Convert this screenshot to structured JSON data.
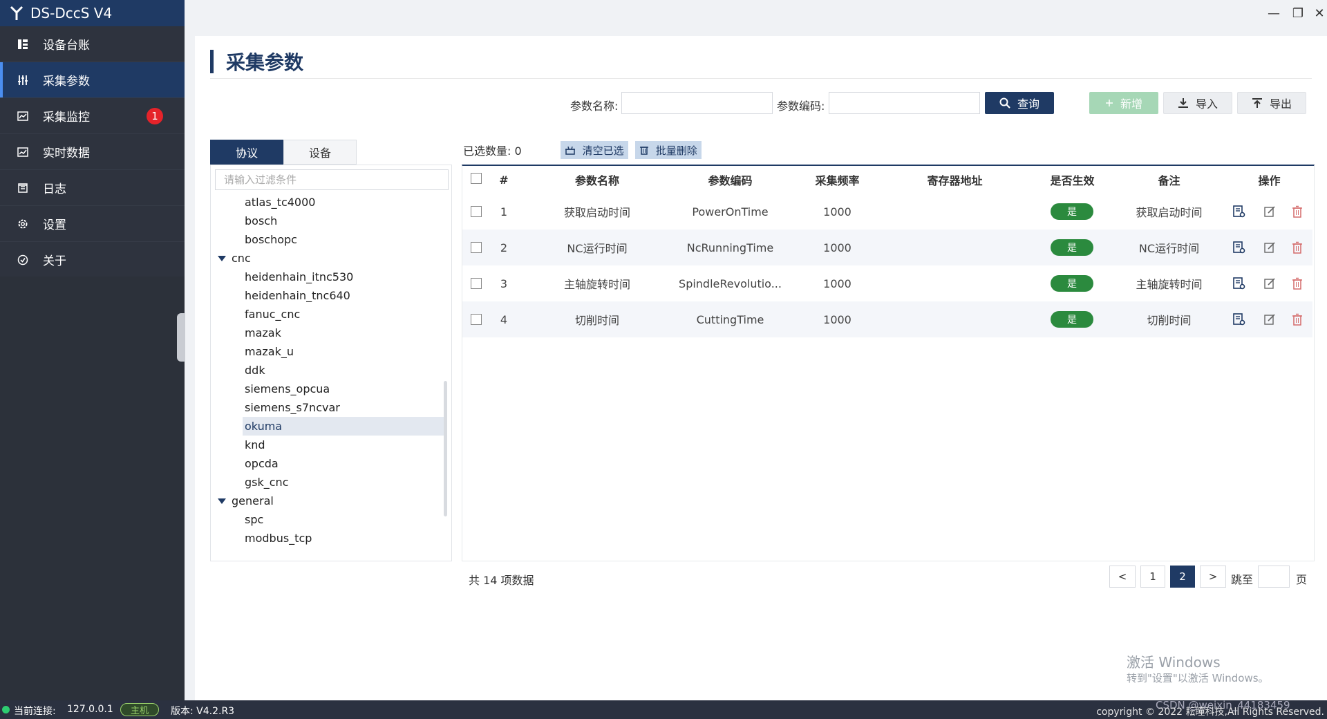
{
  "app": {
    "title": "DS-DccS V4",
    "window_controls": {
      "minimize": "—",
      "maximize": "❐",
      "close": "✕"
    }
  },
  "sidebar": {
    "items": [
      {
        "label": "设备台账",
        "icon": "ledger-icon"
      },
      {
        "label": "采集参数",
        "icon": "sliders-icon",
        "active": true
      },
      {
        "label": "采集监控",
        "icon": "monitor-chart-icon",
        "badge": "1"
      },
      {
        "label": "实时数据",
        "icon": "realtime-chart-icon"
      },
      {
        "label": "日志",
        "icon": "log-icon"
      },
      {
        "label": "设置",
        "icon": "gear-icon"
      },
      {
        "label": "关于",
        "icon": "about-icon"
      }
    ]
  },
  "page": {
    "title": "采集参数"
  },
  "search": {
    "name_label": "参数名称:",
    "name_value": "",
    "code_label": "参数编码:",
    "code_value": "",
    "query_label": "查询",
    "add_label": "新增",
    "import_label": "导入",
    "export_label": "导出"
  },
  "tabs": [
    {
      "label": "协议",
      "active": true
    },
    {
      "label": "设备"
    }
  ],
  "tree": {
    "filter_placeholder": "请输入过滤条件",
    "nodes": [
      {
        "label": "atlas_tc4000",
        "type": "leaf"
      },
      {
        "label": "bosch",
        "type": "leaf"
      },
      {
        "label": "boschopc",
        "type": "leaf"
      },
      {
        "label": "cnc",
        "type": "group"
      },
      {
        "label": "heidenhain_itnc530",
        "type": "leaf"
      },
      {
        "label": "heidenhain_tnc640",
        "type": "leaf"
      },
      {
        "label": "fanuc_cnc",
        "type": "leaf"
      },
      {
        "label": "mazak",
        "type": "leaf"
      },
      {
        "label": "mazak_u",
        "type": "leaf"
      },
      {
        "label": "ddk",
        "type": "leaf"
      },
      {
        "label": "siemens_opcua",
        "type": "leaf"
      },
      {
        "label": "siemens_s7ncvar",
        "type": "leaf"
      },
      {
        "label": "okuma",
        "type": "leaf",
        "selected": true
      },
      {
        "label": "knd",
        "type": "leaf"
      },
      {
        "label": "opcda",
        "type": "leaf"
      },
      {
        "label": "gsk_cnc",
        "type": "leaf"
      },
      {
        "label": "general",
        "type": "group"
      },
      {
        "label": "spc",
        "type": "leaf"
      },
      {
        "label": "modbus_tcp",
        "type": "leaf"
      }
    ]
  },
  "table_toolbar": {
    "selected_count": "已选数量: 0",
    "clear_label": "清空已选",
    "batch_delete_label": "批量删除"
  },
  "table": {
    "columns": [
      "#",
      "参数名称",
      "参数编码",
      "采集频率",
      "寄存器地址",
      "是否生效",
      "备注",
      "操作"
    ],
    "rows": [
      {
        "index": "1",
        "name": "获取启动时间",
        "code": "PowerOnTime",
        "freq": "1000",
        "register": "",
        "enabled": "是",
        "remark": "获取启动时间"
      },
      {
        "index": "2",
        "name": "NC运行时间",
        "code": "NcRunningTime",
        "freq": "1000",
        "register": "",
        "enabled": "是",
        "remark": "NC运行时间"
      },
      {
        "index": "3",
        "name": "主轴旋转时间",
        "code": "SpindleRevolutio...",
        "freq": "1000",
        "register": "",
        "enabled": "是",
        "remark": "主轴旋转时间"
      },
      {
        "index": "4",
        "name": "切削时间",
        "code": "CuttingTime",
        "freq": "1000",
        "register": "",
        "enabled": "是",
        "remark": "切削时间"
      }
    ]
  },
  "pagination": {
    "total": "共 14 项数据",
    "prev": "<",
    "pages": [
      "1",
      "2"
    ],
    "current": "2",
    "next": ">",
    "jump_label": "跳至",
    "jump_value": "",
    "page_suffix": "页"
  },
  "watermark": {
    "line1": "激活 Windows",
    "line2": "转到\"设置\"以激活 Windows。"
  },
  "status": {
    "connection_label": "当前连接:",
    "ip": "127.0.0.1",
    "host_badge": "主机",
    "version": "版本: V4.2.R3",
    "copyright": "copyright © 2022 耘瞳科技,All Rights Reserved.",
    "overlay": "CSDN @weixin_44183459"
  },
  "colors": {
    "primary": "#1f3a64",
    "sidebar_bg": "#2e333e",
    "enabled_pill": "#2b8a3e",
    "badge": "#e5232a",
    "add_disabled": "#a6d7b6"
  }
}
